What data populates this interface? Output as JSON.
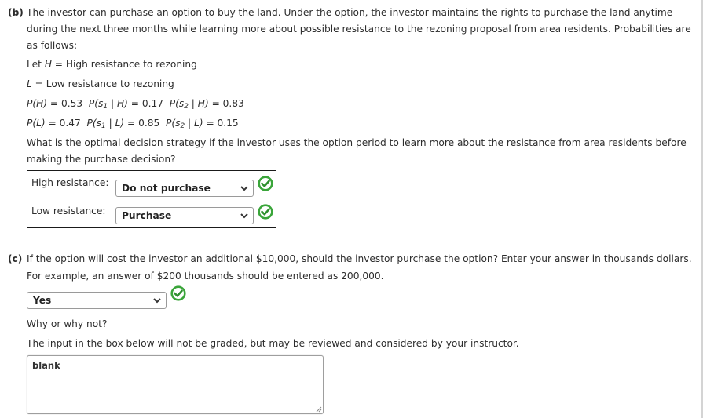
{
  "colors": {
    "check_green": "#3aa53a",
    "text": "#2d2d2d",
    "box_border": "#1a1a1a"
  },
  "part_b": {
    "label": "(b)",
    "intro_lines": [
      "The investor can purchase an option to buy the land. Under the option, the investor maintains the rights to purchase the land anytime",
      "during the next three months while learning more about possible resistance to the rezoning proposal from area residents. Probabilities are",
      "as follows:"
    ],
    "def_h": {
      "prefix": "Let ",
      "var": "H",
      "text": " = High resistance to rezoning"
    },
    "def_l": {
      "var": "L",
      "text": " = Low resistance to rezoning"
    },
    "prob_row_1": {
      "p_state": "P(H)",
      "p_state_val": " = 0.53",
      "p_s1": "P(s",
      "s1_sub": "1",
      "s1_cond": " | H)",
      "p_s1_val": " = 0.17",
      "p_s2": "P(s",
      "s2_sub": "2",
      "s2_cond": " | H)",
      "p_s2_val": " = 0.83"
    },
    "prob_row_2": {
      "p_state": "P(L)",
      "p_state_val": " = 0.47",
      "p_s1": "P(s",
      "s1_sub": "1",
      "s1_cond": " | L)",
      "p_s1_val": " = 0.85",
      "p_s2": "P(s",
      "s2_sub": "2",
      "s2_cond": " | L)",
      "p_s2_val": " = 0.15"
    },
    "question_lines": [
      "What is the optimal decision strategy if the investor uses the option period to learn more about the resistance from area residents before",
      "making the purchase decision?"
    ],
    "strategy": [
      {
        "label": "High resistance:",
        "selected": "Do not purchase",
        "status_icon": "check-correct-icon"
      },
      {
        "label": "Low resistance:",
        "selected": "Purchase",
        "status_icon": "check-correct-icon"
      }
    ]
  },
  "part_c": {
    "label": "(c)",
    "question_lines": [
      "If the option will cost the investor an additional $10,000, should the investor purchase the option? Enter your answer in thousands dollars.",
      "For example, an answer of $200 thousands should be entered as 200,000."
    ],
    "answer": {
      "selected": "Yes",
      "status_icon": "check-correct-icon"
    },
    "why_label": "Why or why not?",
    "note": "The input in the box below will not be graded, but may be reviewed and considered by your instructor.",
    "textarea_value": "blank"
  }
}
